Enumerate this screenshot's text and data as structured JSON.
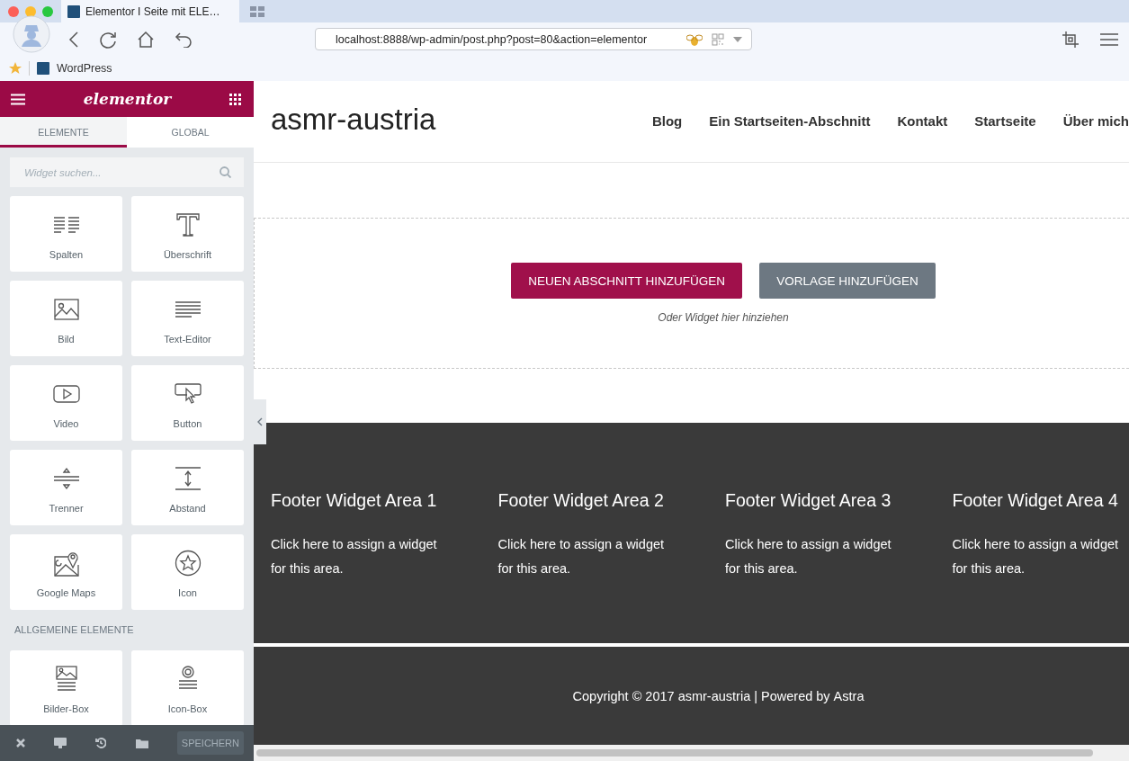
{
  "browser": {
    "tab_title": "Elementor I Seite mit ELE…",
    "address": "localhost:8888/wp-admin/post.php?post=80&action=elementor",
    "bookmarks": [
      "WordPress"
    ]
  },
  "sidebar": {
    "logo": "elementor",
    "tabs": [
      {
        "label": "ELEMENTE",
        "selected": true
      },
      {
        "label": "GLOBAL",
        "selected": false
      }
    ],
    "search": {
      "placeholder": "Widget suchen..."
    },
    "widgets": [
      {
        "label": "Spalten",
        "kind": "columns"
      },
      {
        "label": "Überschrift",
        "kind": "heading"
      },
      {
        "label": "Bild",
        "kind": "image"
      },
      {
        "label": "Text-Editor",
        "kind": "text"
      },
      {
        "label": "Video",
        "kind": "video"
      },
      {
        "label": "Button",
        "kind": "button"
      },
      {
        "label": "Trenner",
        "kind": "divider"
      },
      {
        "label": "Abstand",
        "kind": "spacer"
      },
      {
        "label": "Google Maps",
        "kind": "map"
      },
      {
        "label": "Icon",
        "kind": "star"
      }
    ],
    "section_heading": "ALLGEMEINE ELEMENTE",
    "general_widgets": [
      {
        "label": "Bilder-Box",
        "kind": "image-box"
      },
      {
        "label": "Icon-Box",
        "kind": "icon-box"
      }
    ],
    "save_button": "SPEICHERN"
  },
  "site": {
    "title": "asmr-austria",
    "menu": [
      "Blog",
      "Ein Startseiten-Abschnitt",
      "Kontakt",
      "Startseite",
      "Über mich"
    ],
    "buttons": [
      {
        "label": "NEUEN ABSCHNITT HINZUFÜGEN",
        "kind": "primary"
      },
      {
        "label": "VORLAGE HINZUFÜGEN",
        "kind": "secondary"
      }
    ],
    "drop_hint": "Oder Widget hier hinziehen",
    "footer_widgets": [
      {
        "title": "Footer Widget Area 1",
        "text": "Click here to assign a widget for this area."
      },
      {
        "title": "Footer Widget Area 2",
        "text": "Click here to assign a widget for this area."
      },
      {
        "title": "Footer Widget Area 3",
        "text": "Click here to assign a widget for this area."
      },
      {
        "title": "Footer Widget Area 4",
        "text": "Click here to assign a widget for this area."
      }
    ],
    "copyright": "Copyright © 2017 asmr-austria | Powered by",
    "copyright_link": "Astra"
  }
}
